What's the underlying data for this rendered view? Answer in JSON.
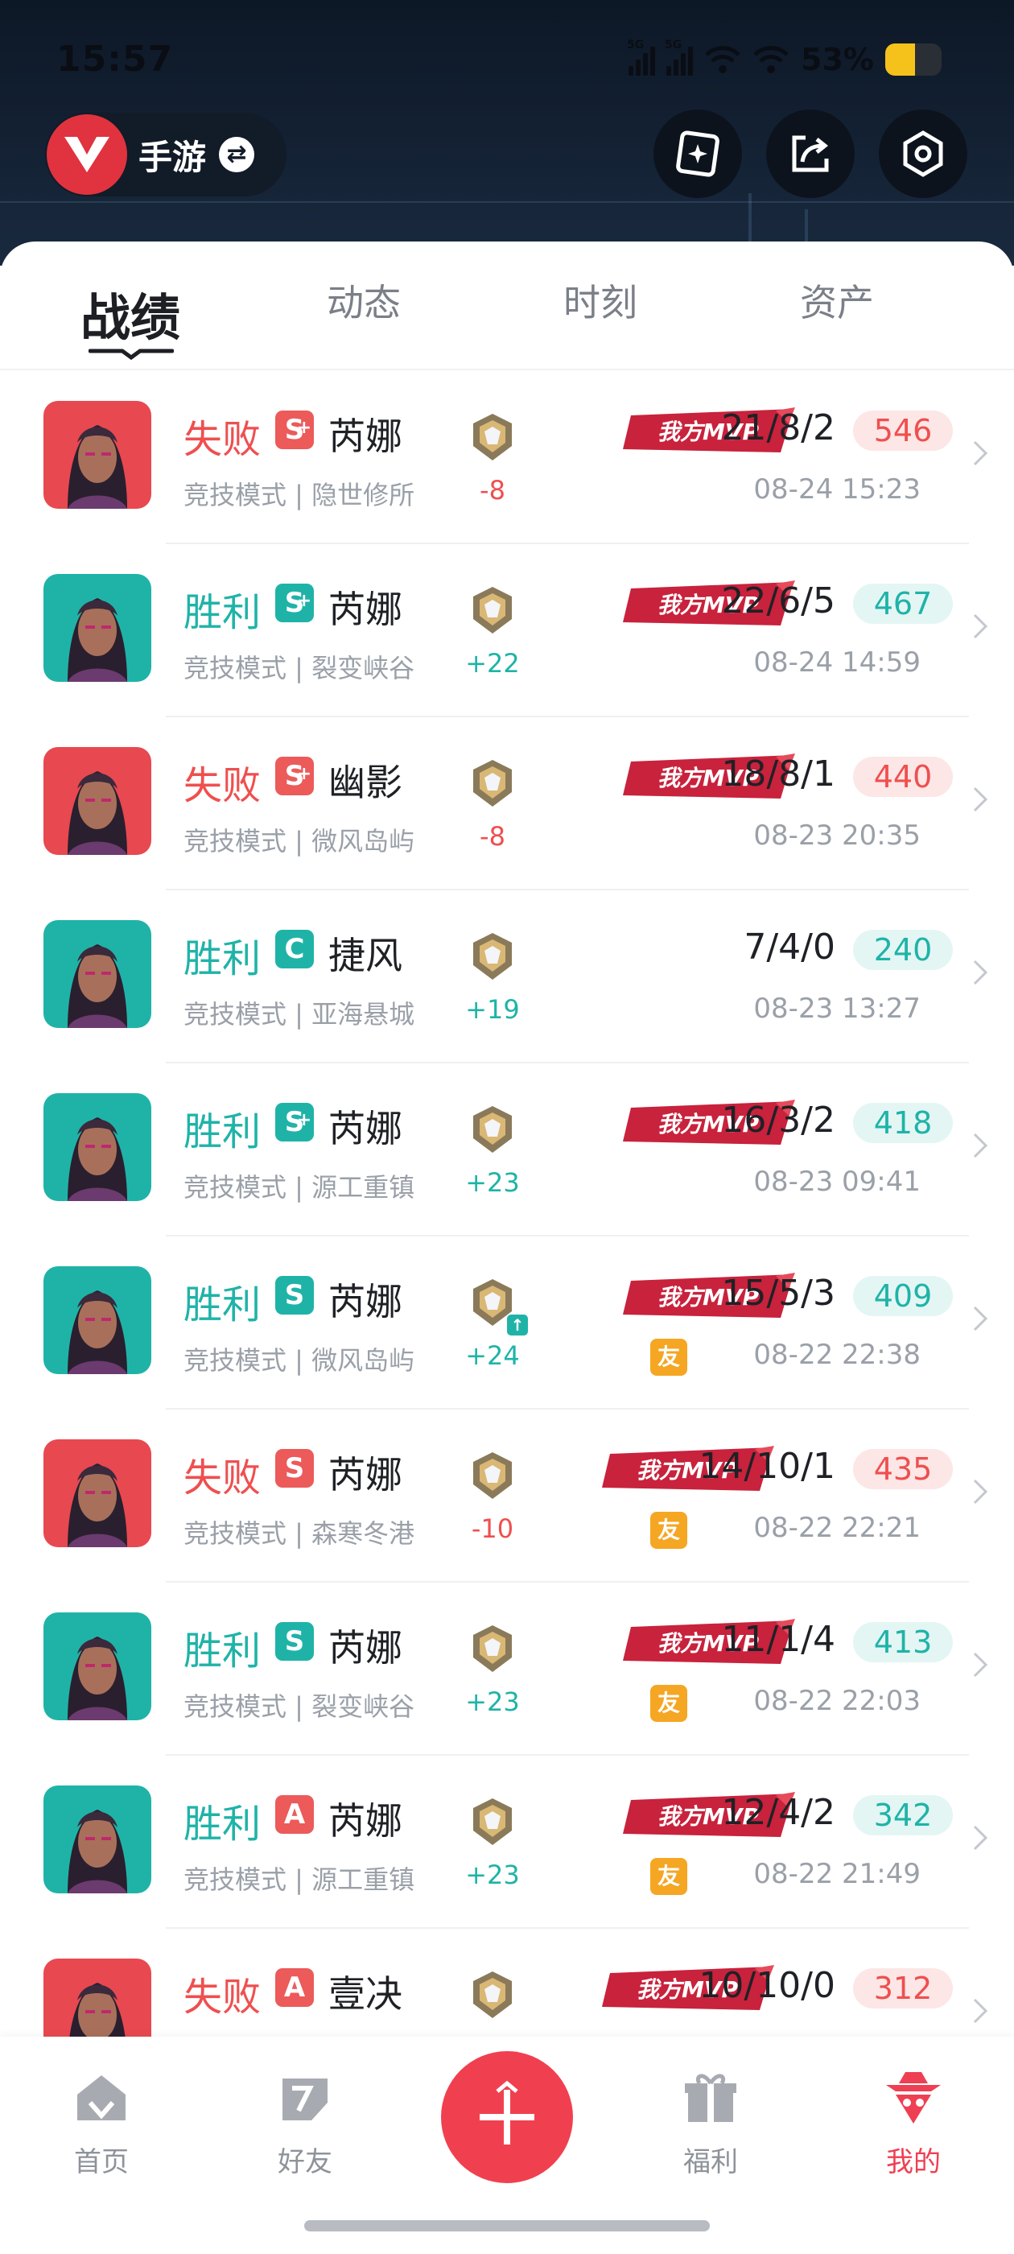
{
  "status_bar": {
    "time": "15:57",
    "battery": "53%",
    "battery_level": 0.53,
    "network_a": "5G",
    "network_b": "5G"
  },
  "header": {
    "game_switch_label": "手游",
    "logo_icon": "valorant-logo-icon",
    "buttons": [
      "ai-sparkle-icon",
      "share-icon",
      "settings-hex-icon"
    ]
  },
  "tabs": [
    {
      "label": "战绩",
      "active": true
    },
    {
      "label": "动态",
      "active": false
    },
    {
      "label": "时刻",
      "active": false
    },
    {
      "label": "资产",
      "active": false
    }
  ],
  "matches": [
    {
      "result": "失败",
      "outcome": "lose",
      "grade": "S",
      "grade_plus": true,
      "hero": "芮娜",
      "mode": "竞技模式 | 隐世修所",
      "rank_delta": "-8",
      "rank_up": false,
      "mvp": true,
      "mvp_label": "我方MVP",
      "kda": "21/8/2",
      "score": "546",
      "datetime": "08-24 15:23",
      "friend": false,
      "avatar_bg": "#e84850"
    },
    {
      "result": "胜利",
      "outcome": "win",
      "grade": "S",
      "grade_plus": true,
      "hero": "芮娜",
      "mode": "竞技模式 | 裂变峡谷",
      "rank_delta": "+22",
      "rank_up": false,
      "mvp": true,
      "mvp_label": "我方MVP",
      "kda": "22/6/5",
      "score": "467",
      "datetime": "08-24 14:59",
      "friend": false,
      "avatar_bg": "#1fb3a8"
    },
    {
      "result": "失败",
      "outcome": "lose",
      "grade": "S",
      "grade_plus": true,
      "hero": "幽影",
      "mode": "竞技模式 | 微风岛屿",
      "rank_delta": "-8",
      "rank_up": false,
      "mvp": true,
      "mvp_label": "我方MVP",
      "kda": "18/8/1",
      "score": "440",
      "datetime": "08-23 20:35",
      "friend": false,
      "avatar_bg": "#e84850"
    },
    {
      "result": "胜利",
      "outcome": "win",
      "grade": "C",
      "grade_plus": false,
      "hero": "捷风",
      "mode": "竞技模式 | 亚海悬城",
      "rank_delta": "+19",
      "rank_up": false,
      "mvp": false,
      "mvp_label": "",
      "kda": "7/4/0",
      "score": "240",
      "datetime": "08-23 13:27",
      "friend": false,
      "avatar_bg": "#1fb3a8"
    },
    {
      "result": "胜利",
      "outcome": "win",
      "grade": "S",
      "grade_plus": true,
      "hero": "芮娜",
      "mode": "竞技模式 | 源工重镇",
      "rank_delta": "+23",
      "rank_up": false,
      "mvp": true,
      "mvp_label": "我方MVP",
      "kda": "16/3/2",
      "score": "418",
      "datetime": "08-23 09:41",
      "friend": false,
      "avatar_bg": "#1fb3a8"
    },
    {
      "result": "胜利",
      "outcome": "win",
      "grade": "S",
      "grade_plus": false,
      "hero": "芮娜",
      "mode": "竞技模式 | 微风岛屿",
      "rank_delta": "+24",
      "rank_up": true,
      "mvp": true,
      "mvp_label": "我方MVP",
      "kda": "15/5/3",
      "score": "409",
      "datetime": "08-22 22:38",
      "friend": true,
      "friend_label": "友",
      "avatar_bg": "#1fb3a8"
    },
    {
      "result": "失败",
      "outcome": "lose",
      "grade": "S",
      "grade_plus": false,
      "hero": "芮娜",
      "mode": "竞技模式 | 森寒冬港",
      "rank_delta": "-10",
      "rank_up": false,
      "mvp": true,
      "mvp_label": "我方MVP",
      "kda": "14/10/1",
      "score": "435",
      "datetime": "08-22 22:21",
      "friend": true,
      "friend_label": "友",
      "avatar_bg": "#e84850"
    },
    {
      "result": "胜利",
      "outcome": "win",
      "grade": "S",
      "grade_plus": false,
      "hero": "芮娜",
      "mode": "竞技模式 | 裂变峡谷",
      "rank_delta": "+23",
      "rank_up": false,
      "mvp": true,
      "mvp_label": "我方MVP",
      "kda": "11/1/4",
      "score": "413",
      "datetime": "08-22 22:03",
      "friend": true,
      "friend_label": "友",
      "avatar_bg": "#1fb3a8"
    },
    {
      "result": "胜利",
      "outcome": "win",
      "grade": "A",
      "grade_plus": false,
      "hero": "芮娜",
      "mode": "竞技模式 | 源工重镇",
      "rank_delta": "+23",
      "rank_up": false,
      "mvp": true,
      "mvp_label": "我方MVP",
      "kda": "12/4/2",
      "score": "342",
      "datetime": "08-22 21:49",
      "friend": true,
      "friend_label": "友",
      "avatar_bg": "#1fb3a8"
    },
    {
      "result": "失败",
      "outcome": "lose",
      "grade": "A",
      "grade_plus": false,
      "hero": "壹决",
      "mode": "",
      "rank_delta": "",
      "rank_up": false,
      "mvp": true,
      "mvp_label": "我方MVP",
      "kda": "10/10/0",
      "score": "312",
      "datetime": "",
      "friend": false,
      "avatar_bg": "#e84850"
    }
  ],
  "bottom_nav": [
    {
      "label": "首页",
      "icon": "home-icon",
      "active": false
    },
    {
      "label": "好友",
      "icon": "friends-icon",
      "active": false
    },
    {
      "label": "",
      "icon": "plus-icon",
      "active": false
    },
    {
      "label": "福利",
      "icon": "gift-icon",
      "active": false
    },
    {
      "label": "我的",
      "icon": "profile-icon",
      "active": true
    }
  ],
  "colors": {
    "win": "#1fb3a8",
    "lose": "#ef4f4f",
    "accent": "#f0404f"
  }
}
